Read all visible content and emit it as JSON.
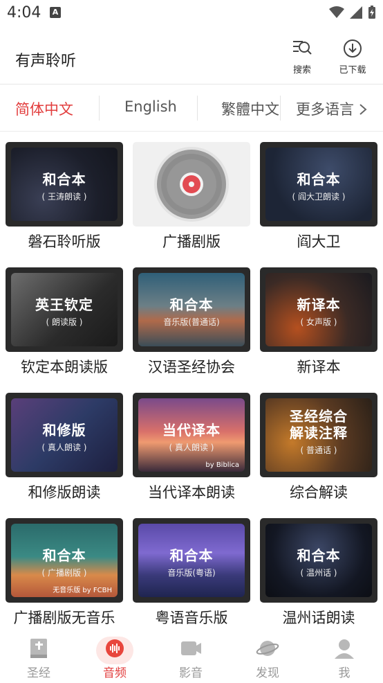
{
  "status_bar": {
    "time": "4:04",
    "notif_letter": "A"
  },
  "header": {
    "title": "有声聆听",
    "search_label": "搜索",
    "download_label": "已下载"
  },
  "languages": {
    "tabs": [
      "简体中文",
      "English",
      "繁體中文"
    ],
    "more_label": "更多语言",
    "more_icon": "chevron-right-icon",
    "active_color": "#e23d3d"
  },
  "grid": {
    "items": [
      {
        "label": "磐石聆听版",
        "thumb_title": "和合本",
        "thumb_sub": "( 王涛朗读 )",
        "corner": "",
        "theme": "dark-bokeh"
      },
      {
        "label": "广播剧版",
        "thumb_title": "",
        "thumb_sub": "",
        "corner": "",
        "theme": "disc"
      },
      {
        "label": "阎大卫",
        "thumb_title": "和合本",
        "thumb_sub": "( 阎大卫朗读 )",
        "corner": "",
        "theme": "night-sky"
      },
      {
        "label": "钦定本朗读版",
        "thumb_title": "英王钦定",
        "thumb_sub": "( 朗读版 )",
        "corner": "",
        "theme": "book-bw"
      },
      {
        "label": "汉语圣经协会",
        "thumb_title": "和合本",
        "thumb_sub": "音乐版(普通话)",
        "corner": "",
        "theme": "sunset-sea"
      },
      {
        "label": "新译本",
        "thumb_title": "新译本",
        "thumb_sub": "( 女声版 )",
        "corner": "",
        "theme": "rain-bokeh"
      },
      {
        "label": "和修版朗读",
        "thumb_title": "和修版",
        "thumb_sub": "( 真人朗读 )",
        "corner": "",
        "theme": "purple-stars"
      },
      {
        "label": "当代译本朗读",
        "thumb_title": "当代译本",
        "thumb_sub": "( 真人朗读 )",
        "corner": "by Biblica",
        "theme": "pink-sunset"
      },
      {
        "label": "综合解读",
        "thumb_title": "圣经综合\n解读注释",
        "thumb_sub": "( 普通话 )",
        "corner": "",
        "theme": "autumn-book"
      },
      {
        "label": "广播剧版无音乐",
        "thumb_title": "和合本",
        "thumb_sub": "( 广播剧版 )",
        "corner": "无音乐版 by FCBH",
        "theme": "teal-orange"
      },
      {
        "label": "粤语音乐版",
        "thumb_title": "和合本",
        "thumb_sub": "音乐版(粤语)",
        "corner": "",
        "theme": "violet-pier"
      },
      {
        "label": "温州话朗读",
        "thumb_title": "和合本",
        "thumb_sub": "( 温州话 )",
        "corner": "",
        "theme": "firework"
      }
    ]
  },
  "bottom_nav": {
    "items": [
      {
        "label": "圣经",
        "icon": "bible-book-icon"
      },
      {
        "label": "音频",
        "icon": "audio-wave-icon"
      },
      {
        "label": "影音",
        "icon": "video-camera-icon"
      },
      {
        "label": "发现",
        "icon": "planet-icon"
      },
      {
        "label": "我",
        "icon": "user-icon"
      }
    ],
    "active_index": 1,
    "active_color": "#e23d3d",
    "inactive_color": "#999999"
  }
}
